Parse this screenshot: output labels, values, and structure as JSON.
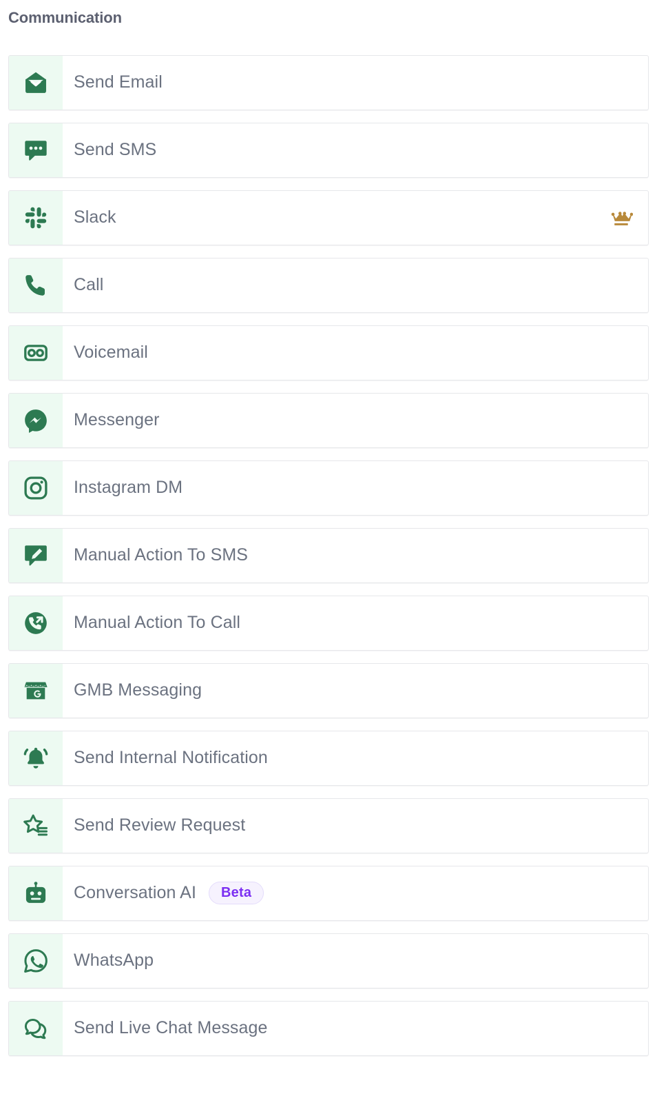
{
  "section": {
    "title": "Communication"
  },
  "colors": {
    "icon_green": "#2d7a52",
    "icon_tile_bg": "#edfaf2",
    "label_text": "#6b7280",
    "heading_text": "#5c6070",
    "card_border": "#e6e7ea",
    "crown_gold": "#b8893a",
    "badge_text": "#7b2ff2",
    "badge_bg": "#f6f2fe",
    "badge_border": "#e4dcfb"
  },
  "badges": {
    "beta_label": "Beta",
    "premium_icon": "crown-icon"
  },
  "actions": [
    {
      "label": "Send Email",
      "icon": "envelope-icon",
      "badge": null,
      "premium": false
    },
    {
      "label": "Send SMS",
      "icon": "chat-dots-icon",
      "badge": null,
      "premium": false
    },
    {
      "label": "Slack",
      "icon": "slack-icon",
      "badge": null,
      "premium": true
    },
    {
      "label": "Call",
      "icon": "phone-icon",
      "badge": null,
      "premium": false
    },
    {
      "label": "Voicemail",
      "icon": "voicemail-icon",
      "badge": null,
      "premium": false
    },
    {
      "label": "Messenger",
      "icon": "messenger-icon",
      "badge": null,
      "premium": false
    },
    {
      "label": "Instagram DM",
      "icon": "instagram-icon",
      "badge": null,
      "premium": false
    },
    {
      "label": "Manual Action To SMS",
      "icon": "chat-pencil-icon",
      "badge": null,
      "premium": false
    },
    {
      "label": "Manual Action To Call",
      "icon": "phone-forward-icon",
      "badge": null,
      "premium": false
    },
    {
      "label": "GMB Messaging",
      "icon": "storefront-g-icon",
      "badge": null,
      "premium": false
    },
    {
      "label": "Send Internal Notification",
      "icon": "bell-ringing-icon",
      "badge": null,
      "premium": false
    },
    {
      "label": "Send Review Request",
      "icon": "star-lines-icon",
      "badge": null,
      "premium": false
    },
    {
      "label": "Conversation AI",
      "icon": "robot-icon",
      "badge": "Beta",
      "premium": false
    },
    {
      "label": "WhatsApp",
      "icon": "whatsapp-icon",
      "badge": null,
      "premium": false
    },
    {
      "label": "Send Live Chat Message",
      "icon": "live-chat-icon",
      "badge": null,
      "premium": false
    }
  ]
}
